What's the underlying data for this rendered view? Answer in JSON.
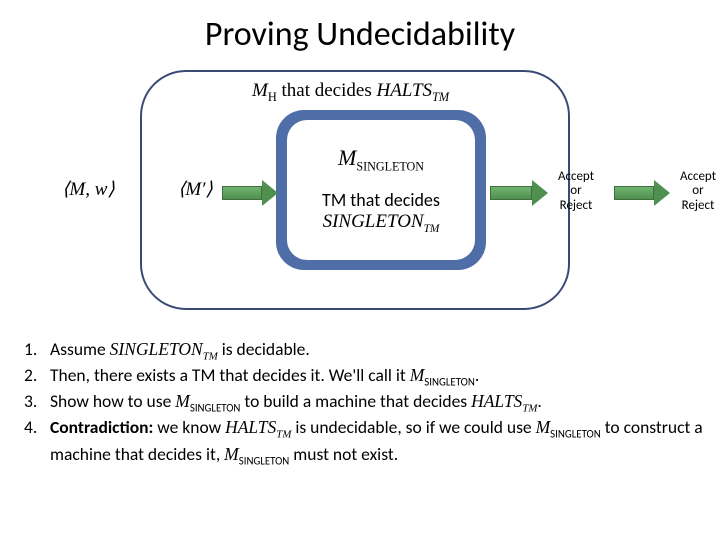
{
  "title": "Proving Undecidability",
  "diagram": {
    "outer_prefix": "M",
    "outer_sub": "H",
    "outer_mid": " that decides ",
    "outer_ital": "HALTS",
    "outer_italsub": "TM",
    "inner_prefix": "M",
    "inner_sub": "SINGLETON",
    "tm_line": "TM that decides",
    "singleton_ital": "SINGLETON",
    "singleton_sub": "TM",
    "input1": "⟨M, w⟩",
    "input2": "⟨M′⟩",
    "accept": "Accept",
    "or": "or",
    "reject": "Reject"
  },
  "steps": {
    "n1": "1.",
    "n2": "2.",
    "n3": "3.",
    "n4": "4.",
    "s1a": "Assume ",
    "s1b": "SINGLETON",
    "s1bsub": "TM",
    "s1c": " is decidable.",
    "s2a": "Then, there exists a TM that decides it.  We'll call it ",
    "s2b": "M",
    "s2bsub": "SINGLETON",
    "s2c": ".",
    "s3a": "Show how to use ",
    "s3b": "M",
    "s3bsub": "SINGLETON",
    "s3c": " to build a machine that decides ",
    "s3d": "HALTS",
    "s3dsub": "TM",
    "s3e": ".",
    "s4a": "Contradiction:",
    "s4b": " we know ",
    "s4c": "HALTS",
    "s4csub": "TM",
    "s4d": " is undecidable, so if we could use ",
    "s4e": "M",
    "s4esub": "SINGLETON",
    "s4f": " to construct a machine that decides it, ",
    "s4g": "M",
    "s4gsub": "SINGLETON",
    "s4h": " must not exist."
  }
}
